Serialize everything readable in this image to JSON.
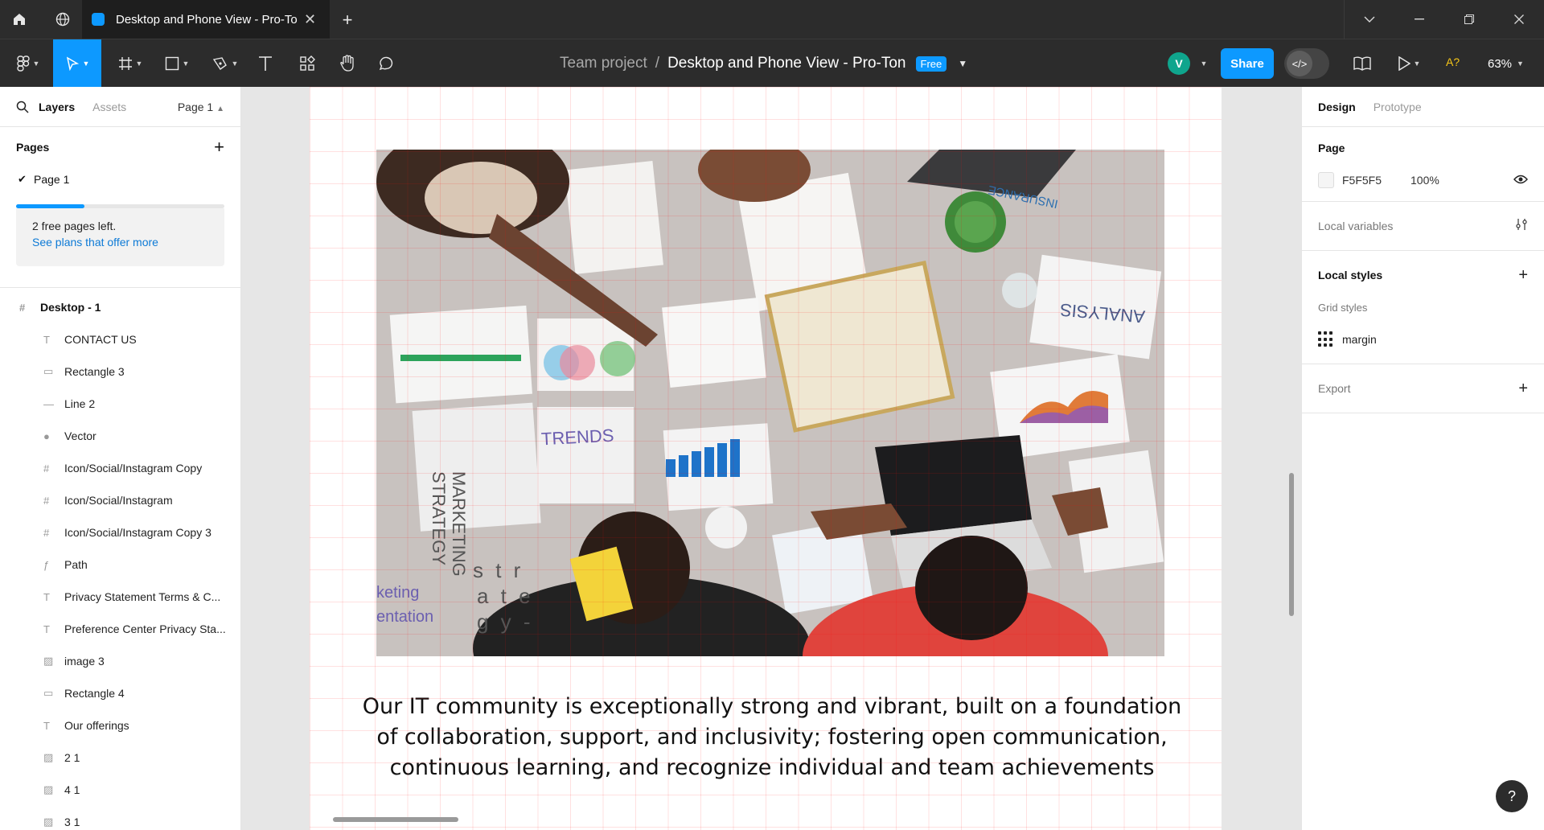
{
  "window": {
    "tab_title": "Desktop and Phone View - Pro-Ton",
    "icons": [
      "home-icon",
      "globe-icon",
      "close-icon",
      "plus-icon",
      "chevron-down-icon",
      "minimize-icon",
      "restore-icon",
      "close-window-icon"
    ]
  },
  "toolbar": {
    "team": "Team project",
    "separator": "/",
    "file": "Desktop and Phone View - Pro-Ton",
    "badge": "Free",
    "avatar": "V",
    "share": "Share",
    "dev_mode": "</>",
    "accessibility": "A?",
    "zoom": "63%",
    "tools": [
      "figma-menu-icon",
      "move-tool-icon",
      "frame-tool-icon",
      "shape-tool-icon",
      "pen-tool-icon",
      "text-tool-icon",
      "resources-icon",
      "hand-tool-icon",
      "comment-icon"
    ],
    "accent_color": "#0d99ff"
  },
  "left_panel": {
    "tabs": {
      "layers": "Layers",
      "assets": "Assets",
      "page": "Page 1"
    },
    "pages_title": "Pages",
    "pages": [
      "Page 1"
    ],
    "free_pages_used": 0.33,
    "promo": {
      "line1": "2 free pages left.",
      "line2": "See plans that offer more"
    },
    "frame_name": "Desktop - 1",
    "layers": [
      {
        "name": "CONTACT US",
        "icon": "T"
      },
      {
        "name": "Rectangle 3",
        "icon": "▭"
      },
      {
        "name": "Line 2",
        "icon": "—"
      },
      {
        "name": "Vector",
        "icon": "●"
      },
      {
        "name": "Icon/Social/Instagram Copy",
        "icon": "#"
      },
      {
        "name": "Icon/Social/Instagram",
        "icon": "#"
      },
      {
        "name": "Icon/Social/Instagram Copy 3",
        "icon": "#"
      },
      {
        "name": "Path",
        "icon": "ƒ"
      },
      {
        "name": "Privacy Statement Terms & C...",
        "icon": "T"
      },
      {
        "name": "Preference Center Privacy Sta...",
        "icon": "T"
      },
      {
        "name": "image 3",
        "icon": "▨"
      },
      {
        "name": "Rectangle 4",
        "icon": "▭"
      },
      {
        "name": "Our offerings",
        "icon": "T"
      },
      {
        "name": "2 1",
        "icon": "▨"
      },
      {
        "name": "4 1",
        "icon": "▨"
      },
      {
        "name": "3 1",
        "icon": "▨"
      }
    ]
  },
  "canvas": {
    "photo_text": {
      "trends": "TRENDS",
      "marketing": "MARKETING",
      "strategy": "STRATEGY",
      "insurance": "INSURANCE",
      "analysis": "ANALYSIS",
      "str1": "s t r",
      "str2": "a t e",
      "str3": "g y -",
      "keting": "keting",
      "entation": "entation"
    },
    "caption": "Our IT community is exceptionally strong and vibrant, built on a foundation of collaboration, support, and inclusivity; fostering open communication, continuous learning, and recognize individual and team achievements"
  },
  "right_panel": {
    "tabs": {
      "design": "Design",
      "prototype": "Prototype"
    },
    "page_title": "Page",
    "page_fill": {
      "hex": "F5F5F5",
      "opacity": "100%"
    },
    "local_variables": "Local variables",
    "local_styles": "Local styles",
    "grid_styles": "Grid styles",
    "grid_style_name": "margin",
    "export": "Export"
  },
  "help": "?"
}
